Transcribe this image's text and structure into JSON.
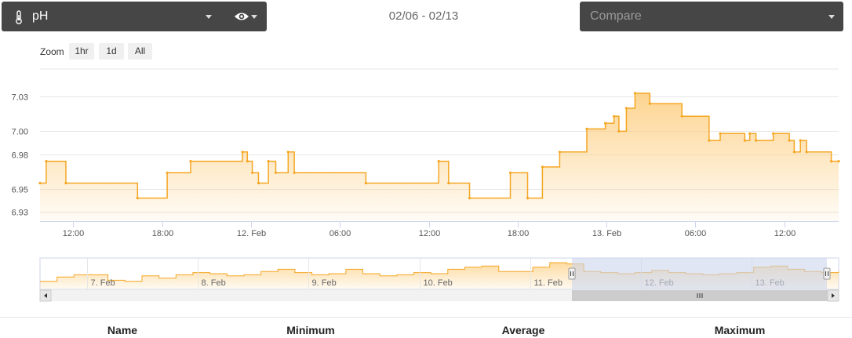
{
  "toolbar": {
    "metric": "pH",
    "date_range": "02/06 - 02/13",
    "compare_placeholder": "Compare"
  },
  "zoom": {
    "label": "Zoom",
    "buttons": [
      "1hr",
      "1d",
      "All"
    ]
  },
  "colors": {
    "series": "#f5a623",
    "area_top": "#fdd28b",
    "navigator_mask": "#ccd6eb",
    "header_bg": "#464646"
  },
  "table": {
    "columns": [
      "Name",
      "Minimum",
      "Average",
      "Maximum"
    ]
  },
  "chart_data": {
    "type": "area",
    "x_type": "datetime",
    "title": "",
    "xlabel": "",
    "ylabel": "",
    "grid": true,
    "y_ticks": [
      "6.93",
      "6.95",
      "6.98",
      "7.00",
      "7.03"
    ],
    "ylim": [
      6.922,
      7.054
    ],
    "xlim": [
      "2025-02-11T09:45",
      "2025-02-13T15:40"
    ],
    "x_ticks": [
      {
        "t": "2025-02-11T12:00",
        "label": "12:00"
      },
      {
        "t": "2025-02-11T18:00",
        "label": "18:00"
      },
      {
        "t": "2025-02-12T00:00",
        "label": "12. Feb"
      },
      {
        "t": "2025-02-12T06:00",
        "label": "06:00"
      },
      {
        "t": "2025-02-12T12:00",
        "label": "12:00"
      },
      {
        "t": "2025-02-12T18:00",
        "label": "18:00"
      },
      {
        "t": "2025-02-13T00:00",
        "label": "13. Feb"
      },
      {
        "t": "2025-02-13T06:00",
        "label": "06:00"
      },
      {
        "t": "2025-02-13T12:00",
        "label": "12:00"
      }
    ],
    "series": [
      {
        "points": [
          [
            "2025-02-11T09:45",
            6.955
          ],
          [
            "2025-02-11T10:10",
            6.974
          ],
          [
            "2025-02-11T11:30",
            6.955
          ],
          [
            "2025-02-11T16:20",
            6.942
          ],
          [
            "2025-02-11T18:20",
            6.964
          ],
          [
            "2025-02-11T19:55",
            6.974
          ],
          [
            "2025-02-11T23:25",
            6.982
          ],
          [
            "2025-02-11T23:45",
            6.974
          ],
          [
            "2025-02-12T00:05",
            6.964
          ],
          [
            "2025-02-12T00:30",
            6.955
          ],
          [
            "2025-02-12T01:10",
            6.974
          ],
          [
            "2025-02-12T01:40",
            6.964
          ],
          [
            "2025-02-12T02:30",
            6.982
          ],
          [
            "2025-02-12T02:55",
            6.964
          ],
          [
            "2025-02-12T07:45",
            6.955
          ],
          [
            "2025-02-12T12:40",
            6.974
          ],
          [
            "2025-02-12T13:20",
            6.955
          ],
          [
            "2025-02-12T14:45",
            6.942
          ],
          [
            "2025-02-12T17:30",
            6.964
          ],
          [
            "2025-02-12T18:40",
            6.942
          ],
          [
            "2025-02-12T19:40",
            6.969
          ],
          [
            "2025-02-12T20:50",
            6.982
          ],
          [
            "2025-02-12T22:40",
            7.002
          ],
          [
            "2025-02-12T23:55",
            7.007
          ],
          [
            "2025-02-13T00:30",
            7.013
          ],
          [
            "2025-02-13T00:50",
            7.0
          ],
          [
            "2025-02-13T01:20",
            7.02
          ],
          [
            "2025-02-13T01:55",
            7.033
          ],
          [
            "2025-02-13T02:55",
            7.024
          ],
          [
            "2025-02-13T05:05",
            7.013
          ],
          [
            "2025-02-13T06:55",
            6.992
          ],
          [
            "2025-02-13T07:40",
            6.998
          ],
          [
            "2025-02-13T09:20",
            6.992
          ],
          [
            "2025-02-13T09:40",
            6.998
          ],
          [
            "2025-02-13T10:05",
            6.992
          ],
          [
            "2025-02-13T11:15",
            6.998
          ],
          [
            "2025-02-13T12:20",
            6.992
          ],
          [
            "2025-02-13T12:40",
            6.982
          ],
          [
            "2025-02-13T13:05",
            6.992
          ],
          [
            "2025-02-13T13:30",
            6.982
          ],
          [
            "2025-02-13T15:10",
            6.974
          ],
          [
            "2025-02-13T15:40",
            6.974
          ]
        ]
      }
    ],
    "navigator": {
      "x_ticks": [
        "7. Feb",
        "8. Feb",
        "9. Feb",
        "10. Feb",
        "11. Feb",
        "12. Feb",
        "13. Feb"
      ],
      "selection": [
        "2025-02-11T09:45",
        "2025-02-13T15:40"
      ]
    }
  }
}
